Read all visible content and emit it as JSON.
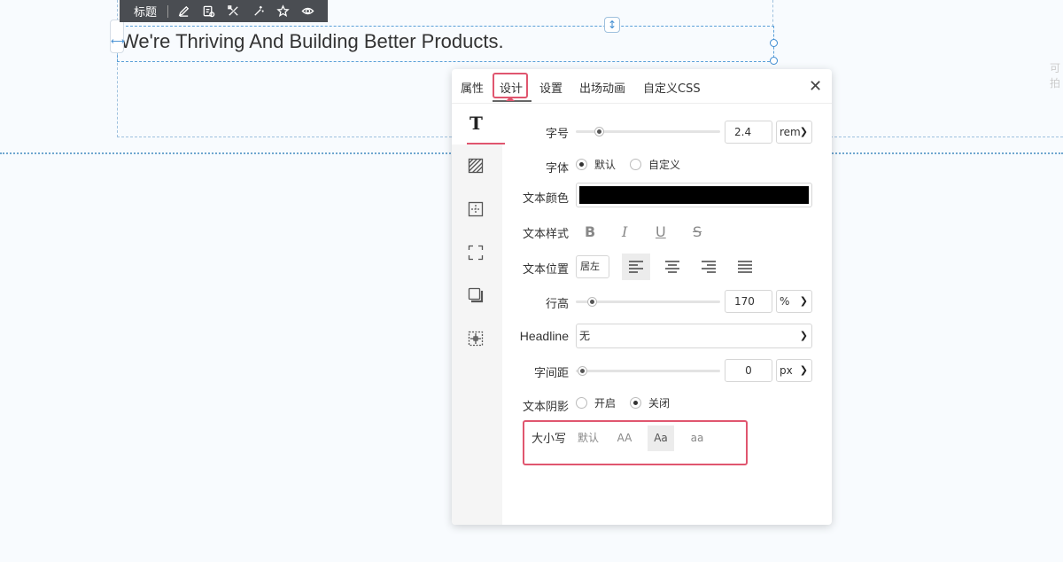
{
  "canvas": {
    "heading_text": "We're Thriving And Building Better Products.",
    "side_text": "可拍"
  },
  "toolbar": {
    "label": "标题",
    "icons": [
      "edit-icon",
      "settings-card-icon",
      "magic-tools-icon",
      "sparkle-wand-icon",
      "star-icon",
      "eye-icon"
    ]
  },
  "panel": {
    "tabs": [
      {
        "label": "属性",
        "active": false
      },
      {
        "label": "设计",
        "active": true
      },
      {
        "label": "设置",
        "active": false
      },
      {
        "label": "出场动画",
        "active": false
      },
      {
        "label": "自定义CSS",
        "active": false
      }
    ],
    "close_glyph": "✕",
    "sidebar": {
      "active_glyph": "T",
      "icons": [
        "text-icon",
        "background-pattern-icon",
        "spacing-icon",
        "border-icon",
        "shadow-icon",
        "position-icon"
      ]
    },
    "font_size": {
      "label": "字号",
      "value": "2.4",
      "unit": "rem",
      "slider_fraction": 0.15
    },
    "font_family": {
      "label": "字体",
      "options": [
        {
          "label": "默认",
          "checked": true
        },
        {
          "label": "自定义",
          "checked": false
        }
      ]
    },
    "text_color": {
      "label": "文本颜色",
      "value": "#000000"
    },
    "text_style": {
      "label": "文本样式",
      "bold": "B",
      "italic": "I",
      "underline": "U",
      "strike": "S"
    },
    "text_align": {
      "label": "文本位置",
      "value": "居左",
      "active_index": 0
    },
    "line_height": {
      "label": "行高",
      "value": "170",
      "unit": "%",
      "slider_fraction": 0.1
    },
    "headline": {
      "label": "Headline",
      "value": "无"
    },
    "letter_spacing": {
      "label": "字间距",
      "value": "0",
      "unit": "px",
      "slider_fraction": 0.03
    },
    "text_shadow": {
      "label": "文本阴影",
      "options": [
        {
          "label": "开启",
          "checked": false
        },
        {
          "label": "关闭",
          "checked": true
        }
      ]
    },
    "text_case": {
      "label": "大小写",
      "options": [
        "默认",
        "AA",
        "Aa",
        "aa"
      ],
      "active_index": 2
    },
    "colors": {
      "accent": "#e0566f",
      "selection": "#3d8bd1"
    }
  }
}
